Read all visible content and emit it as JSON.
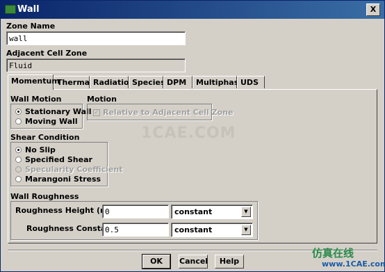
{
  "window": {
    "title": "Wall",
    "close_glyph": "X"
  },
  "zone_name": {
    "label": "Zone Name",
    "value": "wall"
  },
  "adjacent_cell_zone": {
    "label": "Adjacent Cell Zone",
    "value": "Fluid"
  },
  "tabs": [
    {
      "label": "Momentum",
      "active": true
    },
    {
      "label": "Thermal"
    },
    {
      "label": "Radiation"
    },
    {
      "label": "Species"
    },
    {
      "label": "DPM"
    },
    {
      "label": "Multiphase"
    },
    {
      "label": "UDS"
    }
  ],
  "wall_motion": {
    "label": "Wall Motion",
    "options": [
      {
        "label": "Stationary Wall",
        "selected": true
      },
      {
        "label": "Moving Wall",
        "selected": false
      }
    ]
  },
  "motion": {
    "label": "Motion",
    "checkbox_label": "Relative to Adjacent Cell Zone",
    "checkbox_checked": true,
    "checkbox_enabled": false
  },
  "shear_condition": {
    "label": "Shear Condition",
    "options": [
      {
        "label": "No Slip",
        "selected": true
      },
      {
        "label": "Specified Shear",
        "selected": false
      },
      {
        "label": "Specularity Coefficient",
        "selected": false,
        "disabled": true
      },
      {
        "label": "Marangoni Stress",
        "selected": false
      }
    ]
  },
  "wall_roughness": {
    "label": "Wall Roughness",
    "height": {
      "label": "Roughness Height (mm)",
      "value": "0",
      "method": "constant"
    },
    "constant": {
      "label": "Roughness Constant",
      "value": "0.5",
      "method": "constant"
    }
  },
  "buttons": {
    "ok": "OK",
    "cancel": "Cancel",
    "help": "Help"
  },
  "watermarks": {
    "center": "1CAE.COM",
    "corner_cn": "仿真在线",
    "corner_url": "www.1CAE.com"
  }
}
